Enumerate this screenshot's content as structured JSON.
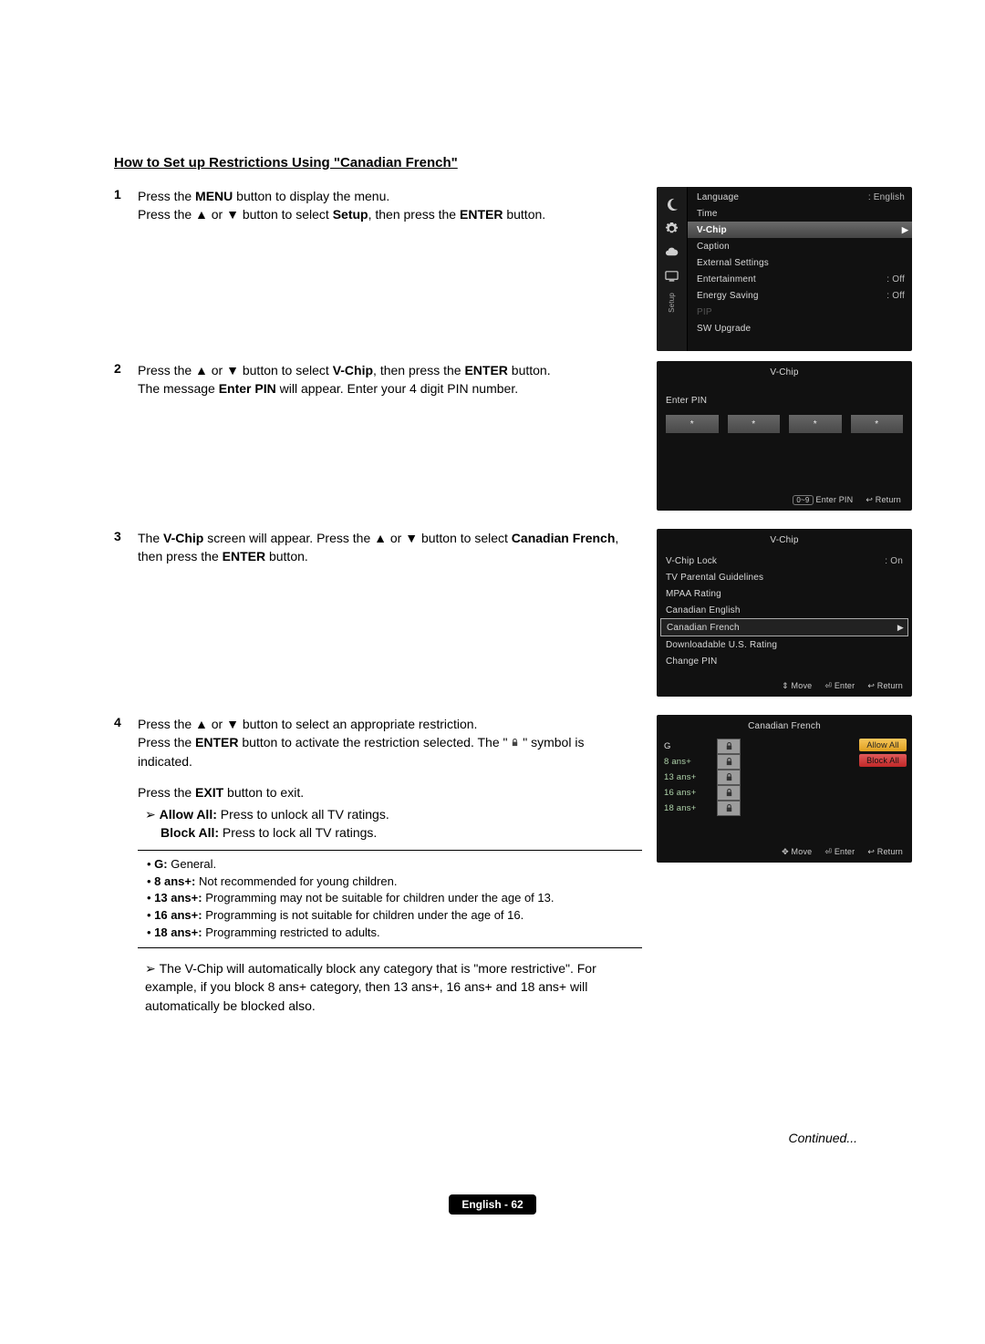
{
  "title": "How to Set up Restrictions Using \"Canadian French\"",
  "steps": {
    "s1": {
      "num": "1",
      "line1a": "Press the ",
      "line1b": "MENU",
      "line1c": " button to display the menu.",
      "line2a": "Press the ▲ or ▼ button to select ",
      "line2b": "Setup",
      "line2c": ", then press the ",
      "line2d": "ENTER",
      "line2e": " button."
    },
    "s2": {
      "num": "2",
      "line1a": "Press the ▲ or ▼ button to select ",
      "line1b": "V-Chip",
      "line1c": ", then press the ",
      "line1d": "ENTER",
      "line1e": " button.",
      "line2a": "The message ",
      "line2b": "Enter PIN",
      "line2c": " will appear. Enter your 4 digit PIN number."
    },
    "s3": {
      "num": "3",
      "line1a": "The ",
      "line1b": "V-Chip",
      "line1c": " screen will appear. Press the ▲ or ▼ button to select ",
      "line1d": "Canadian French",
      "line1e": ", then press the ",
      "line1f": "ENTER",
      "line1g": " button."
    },
    "s4": {
      "num": "4",
      "line1": "Press the ▲ or ▼ button to select an appropriate restriction.",
      "line2a": "Press the ",
      "line2b": "ENTER",
      "line2c": " button to activate the restriction selected. The \" ",
      "line2d": " \" symbol is indicated.",
      "line3a": "Press the ",
      "line3b": "EXIT",
      "line3c": " button to exit.",
      "allow_lead": "➢ ",
      "allow_bold": "Allow All:",
      "allow_rest": " Press to unlock all TV ratings.",
      "block_bold": "Block All:",
      "block_rest": " Press to lock all TV ratings.",
      "note_lead": "➢ ",
      "note1": "The V-Chip will automatically block any category that is \"more restrictive\". For example, if you block 8 ans+ category, then 13 ans+, 16 ans+ and 18 ans+ will automatically be blocked also."
    }
  },
  "defs": {
    "g_b": "G:",
    "g_t": " General.",
    "a8_b": "8 ans+:",
    "a8_t": " Not recommended for young children.",
    "a13_b": "13 ans+:",
    "a13_t": " Programming may not be suitable for children under the age of 13.",
    "a16_b": "16 ans+:",
    "a16_t": " Programming is not suitable for children under the age of 16.",
    "a18_b": "18 ans+:",
    "a18_t": " Programming restricted to adults."
  },
  "continued": "Continued...",
  "page_footer": "English - 62",
  "osd_setup": {
    "side_label": "Setup",
    "items": [
      {
        "label": "Language",
        "value": ": English",
        "hl": false
      },
      {
        "label": "Time",
        "value": "",
        "hl": false
      },
      {
        "label": "V-Chip",
        "value": "",
        "hl": true
      },
      {
        "label": "Caption",
        "value": "",
        "hl": false
      },
      {
        "label": "External Settings",
        "value": "",
        "hl": false
      },
      {
        "label": "Entertainment",
        "value": ": Off",
        "hl": false
      },
      {
        "label": "Energy Saving",
        "value": ": Off",
        "hl": false
      },
      {
        "label": "PIP",
        "value": "",
        "hl": false,
        "dim": true
      },
      {
        "label": "SW Upgrade",
        "value": "",
        "hl": false
      }
    ]
  },
  "osd_pin": {
    "title": "V-Chip",
    "label": "Enter PIN",
    "star": "*",
    "foot_pin": "Enter PIN",
    "foot_pin_badge": "0~9",
    "foot_return": "Return",
    "foot_return_sym": "↩"
  },
  "osd_vchip": {
    "title": "V-Chip",
    "items": [
      {
        "label": "V-Chip Lock",
        "value": ": On"
      },
      {
        "label": "TV Parental Guidelines",
        "value": ""
      },
      {
        "label": "MPAA Rating",
        "value": ""
      },
      {
        "label": "Canadian English",
        "value": ""
      },
      {
        "label": "Canadian French",
        "value": "",
        "sel": true
      },
      {
        "label": "Downloadable U.S. Rating",
        "value": ""
      },
      {
        "label": "Change PIN",
        "value": ""
      }
    ],
    "foot_move": "Move",
    "foot_move_sym": "⇕",
    "foot_enter": "Enter",
    "foot_enter_sym": "⏎",
    "foot_return": "Return",
    "foot_return_sym": "↩"
  },
  "osd_cf": {
    "title": "Canadian French",
    "rows": [
      "G",
      "8 ans+",
      "13 ans+",
      "16 ans+",
      "18 ans+"
    ],
    "allow": "Allow All",
    "block": "Block All",
    "foot_move": "Move",
    "foot_move_sym": "✥",
    "foot_enter": "Enter",
    "foot_enter_sym": "⏎",
    "foot_return": "Return",
    "foot_return_sym": "↩"
  }
}
